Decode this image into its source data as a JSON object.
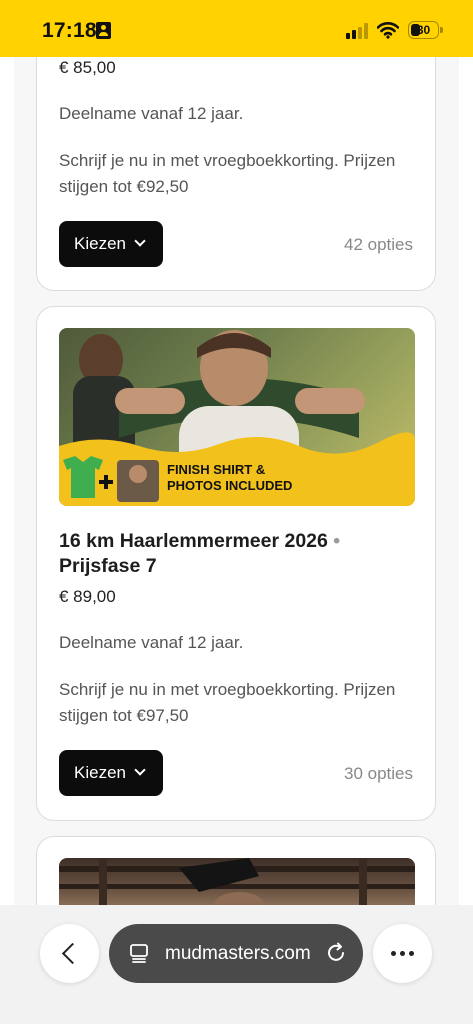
{
  "status_bar": {
    "time": "17:18",
    "battery_percent": "30",
    "signal_bars": 4,
    "signal_bars_active": 2
  },
  "cards": [
    {
      "price": "€ 85,00",
      "age_note": "Deelname vanaf 12 jaar.",
      "description": "Schrijf je nu in met vroegboekkorting. Prijzen stijgen tot €92,50",
      "button_label": "Kiezen",
      "options_count": "42 opties"
    },
    {
      "image_alt": "photo-muddy-runner-carrying-sandbag",
      "title_main": "16 km Haarlemmermeer 2026",
      "title_separator": "•",
      "title_phase": "Prijsfase 7",
      "price": "€ 89,00",
      "age_note": "Deelname vanaf 12 jaar.",
      "description": "Schrijf je nu in met vroegboekkorting. Prijzen stijgen tot €97,50",
      "button_label": "Kiezen",
      "options_count": "30 opties"
    }
  ],
  "browser_bar": {
    "url": "mudmasters.com"
  },
  "colors": {
    "status_bar_bg": "#FFD200",
    "button_bg": "#0c0c0c",
    "url_pill_bg": "#4a4a4a"
  },
  "icons": [
    "id-card-icon",
    "signal-icon",
    "wifi-icon",
    "battery-icon",
    "back-chevron-icon",
    "page-icon",
    "reload-icon",
    "more-dots-icon",
    "chevron-down-icon"
  ]
}
